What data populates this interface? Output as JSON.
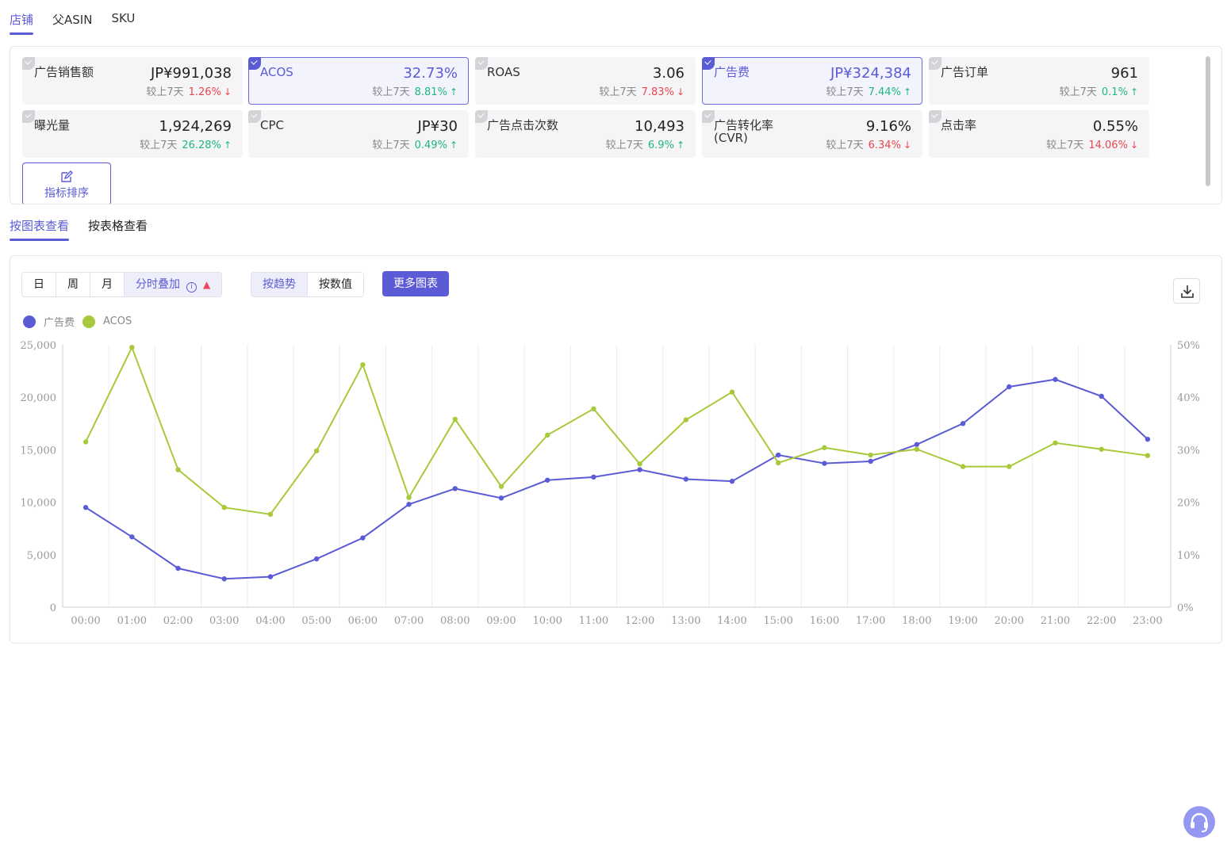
{
  "top_tabs": [
    "店铺",
    "父ASIN",
    "SKU"
  ],
  "metrics": [
    {
      "label": "广告销售额",
      "value": "JP¥991,038",
      "cmp_label": "较上7天",
      "pct": "1.26%",
      "dir": "down",
      "selected": false
    },
    {
      "label": "ACOS",
      "value": "32.73%",
      "cmp_label": "较上7天",
      "pct": "8.81%",
      "dir": "up",
      "selected": true
    },
    {
      "label": "ROAS",
      "value": "3.06",
      "cmp_label": "较上7天",
      "pct": "7.83%",
      "dir": "down",
      "selected": false
    },
    {
      "label": "广告费",
      "value": "JP¥324,384",
      "cmp_label": "较上7天",
      "pct": "7.44%",
      "dir": "up",
      "selected": true
    },
    {
      "label": "广告订单",
      "value": "961",
      "cmp_label": "较上7天",
      "pct": "0.1%",
      "dir": "up",
      "selected": false
    },
    {
      "label": "曝光量",
      "value": "1,924,269",
      "cmp_label": "较上7天",
      "pct": "26.28%",
      "dir": "up",
      "selected": false
    },
    {
      "label": "CPC",
      "value": "JP¥30",
      "cmp_label": "较上7天",
      "pct": "0.49%",
      "dir": "up",
      "selected": false
    },
    {
      "label": "广告点击次数",
      "value": "10,493",
      "cmp_label": "较上7天",
      "pct": "6.9%",
      "dir": "up",
      "selected": false
    },
    {
      "label": "广告转化率 (CVR)",
      "value": "9.16%",
      "cmp_label": "较上7天",
      "pct": "6.34%",
      "dir": "down",
      "selected": false
    },
    {
      "label": "点击率",
      "value": "0.55%",
      "cmp_label": "较上7天",
      "pct": "14.06%",
      "dir": "down",
      "selected": false
    }
  ],
  "sort_button_label": "指标排序",
  "view_tabs": [
    "按图表查看",
    "按表格查看"
  ],
  "period_options": [
    "日",
    "周",
    "月",
    "分时叠加"
  ],
  "mode_options": [
    "按趋势",
    "按数值"
  ],
  "more_charts_label": "更多图表",
  "colors": {
    "accent": "#5b5bd6",
    "series_spend": "#5b5bd6",
    "series_acos": "#a8c93a",
    "up": "#1fb87a",
    "down": "#e8464f"
  },
  "icons": {
    "download": "download-icon",
    "sort": "edit-icon",
    "support": "headset-icon",
    "info": "info-icon",
    "hot": "fire-icon"
  },
  "chart_data": {
    "type": "line",
    "x": [
      "00:00",
      "01:00",
      "02:00",
      "03:00",
      "04:00",
      "05:00",
      "06:00",
      "07:00",
      "08:00",
      "09:00",
      "10:00",
      "11:00",
      "12:00",
      "13:00",
      "14:00",
      "15:00",
      "16:00",
      "17:00",
      "18:00",
      "19:00",
      "20:00",
      "21:00",
      "22:00",
      "23:00"
    ],
    "series": [
      {
        "name": "广告费",
        "axis": "left",
        "color": "#5b5bd6",
        "values": [
          9500,
          6700,
          3700,
          2700,
          2900,
          4600,
          6600,
          9800,
          11300,
          10400,
          12100,
          12400,
          13100,
          12200,
          12000,
          14500,
          13700,
          13900,
          15500,
          17500,
          21000,
          21700,
          20100,
          16000
        ]
      },
      {
        "name": "ACOS",
        "axis": "right",
        "color": "#a8c93a",
        "values": [
          31.5,
          49.5,
          26.2,
          19.0,
          17.7,
          29.8,
          46.2,
          20.9,
          35.8,
          23.0,
          32.8,
          37.8,
          27.3,
          35.7,
          41.0,
          27.5,
          30.4,
          29.0,
          30.1,
          26.8,
          26.8,
          31.3,
          30.1,
          28.9
        ]
      }
    ],
    "y_left_ticks": [
      "25,000",
      "20,000",
      "15,000",
      "10,000",
      "5,000",
      "0"
    ],
    "y_right_ticks": [
      "50%",
      "40%",
      "30%",
      "20%",
      "10%",
      "0%"
    ],
    "ylim_left": [
      0,
      25000
    ],
    "ylim_right": [
      0,
      50
    ],
    "grid": "vertical",
    "legend": "top-left"
  }
}
